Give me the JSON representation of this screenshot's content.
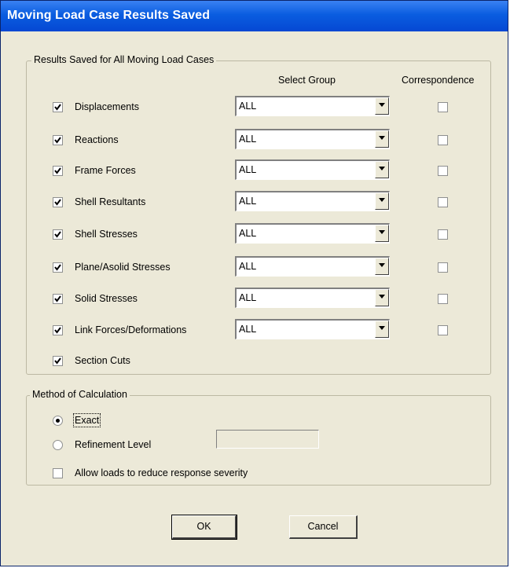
{
  "window": {
    "title": "Moving Load Case Results Saved"
  },
  "results_group": {
    "legend": "Results Saved for All Moving Load Cases",
    "col_select_group": "Select Group",
    "col_correspondence": "Correspondence",
    "rows": [
      {
        "label": "Displacements",
        "checked": true,
        "group": "ALL",
        "correspondence": false
      },
      {
        "label": "Reactions",
        "checked": true,
        "group": "ALL",
        "correspondence": false
      },
      {
        "label": "Frame Forces",
        "checked": true,
        "group": "ALL",
        "correspondence": false
      },
      {
        "label": "Shell Resultants",
        "checked": true,
        "group": "ALL",
        "correspondence": false
      },
      {
        "label": "Shell Stresses",
        "checked": true,
        "group": "ALL",
        "correspondence": false
      },
      {
        "label": "Plane/Asolid Stresses",
        "checked": true,
        "group": "ALL",
        "correspondence": false
      },
      {
        "label": "Solid Stresses",
        "checked": true,
        "group": "ALL",
        "correspondence": false
      },
      {
        "label": "Link Forces/Deformations",
        "checked": true,
        "group": "ALL",
        "correspondence": false
      }
    ],
    "section_cuts": {
      "label": "Section Cuts",
      "checked": true
    }
  },
  "method_group": {
    "legend": "Method of Calculation",
    "exact_label": "Exact",
    "refinement_label": "Refinement Level",
    "refinement_value": "",
    "selected": "Exact",
    "allow_loads_label": "Allow loads to reduce response severity",
    "allow_loads_checked": false
  },
  "buttons": {
    "ok": "OK",
    "cancel": "Cancel"
  }
}
